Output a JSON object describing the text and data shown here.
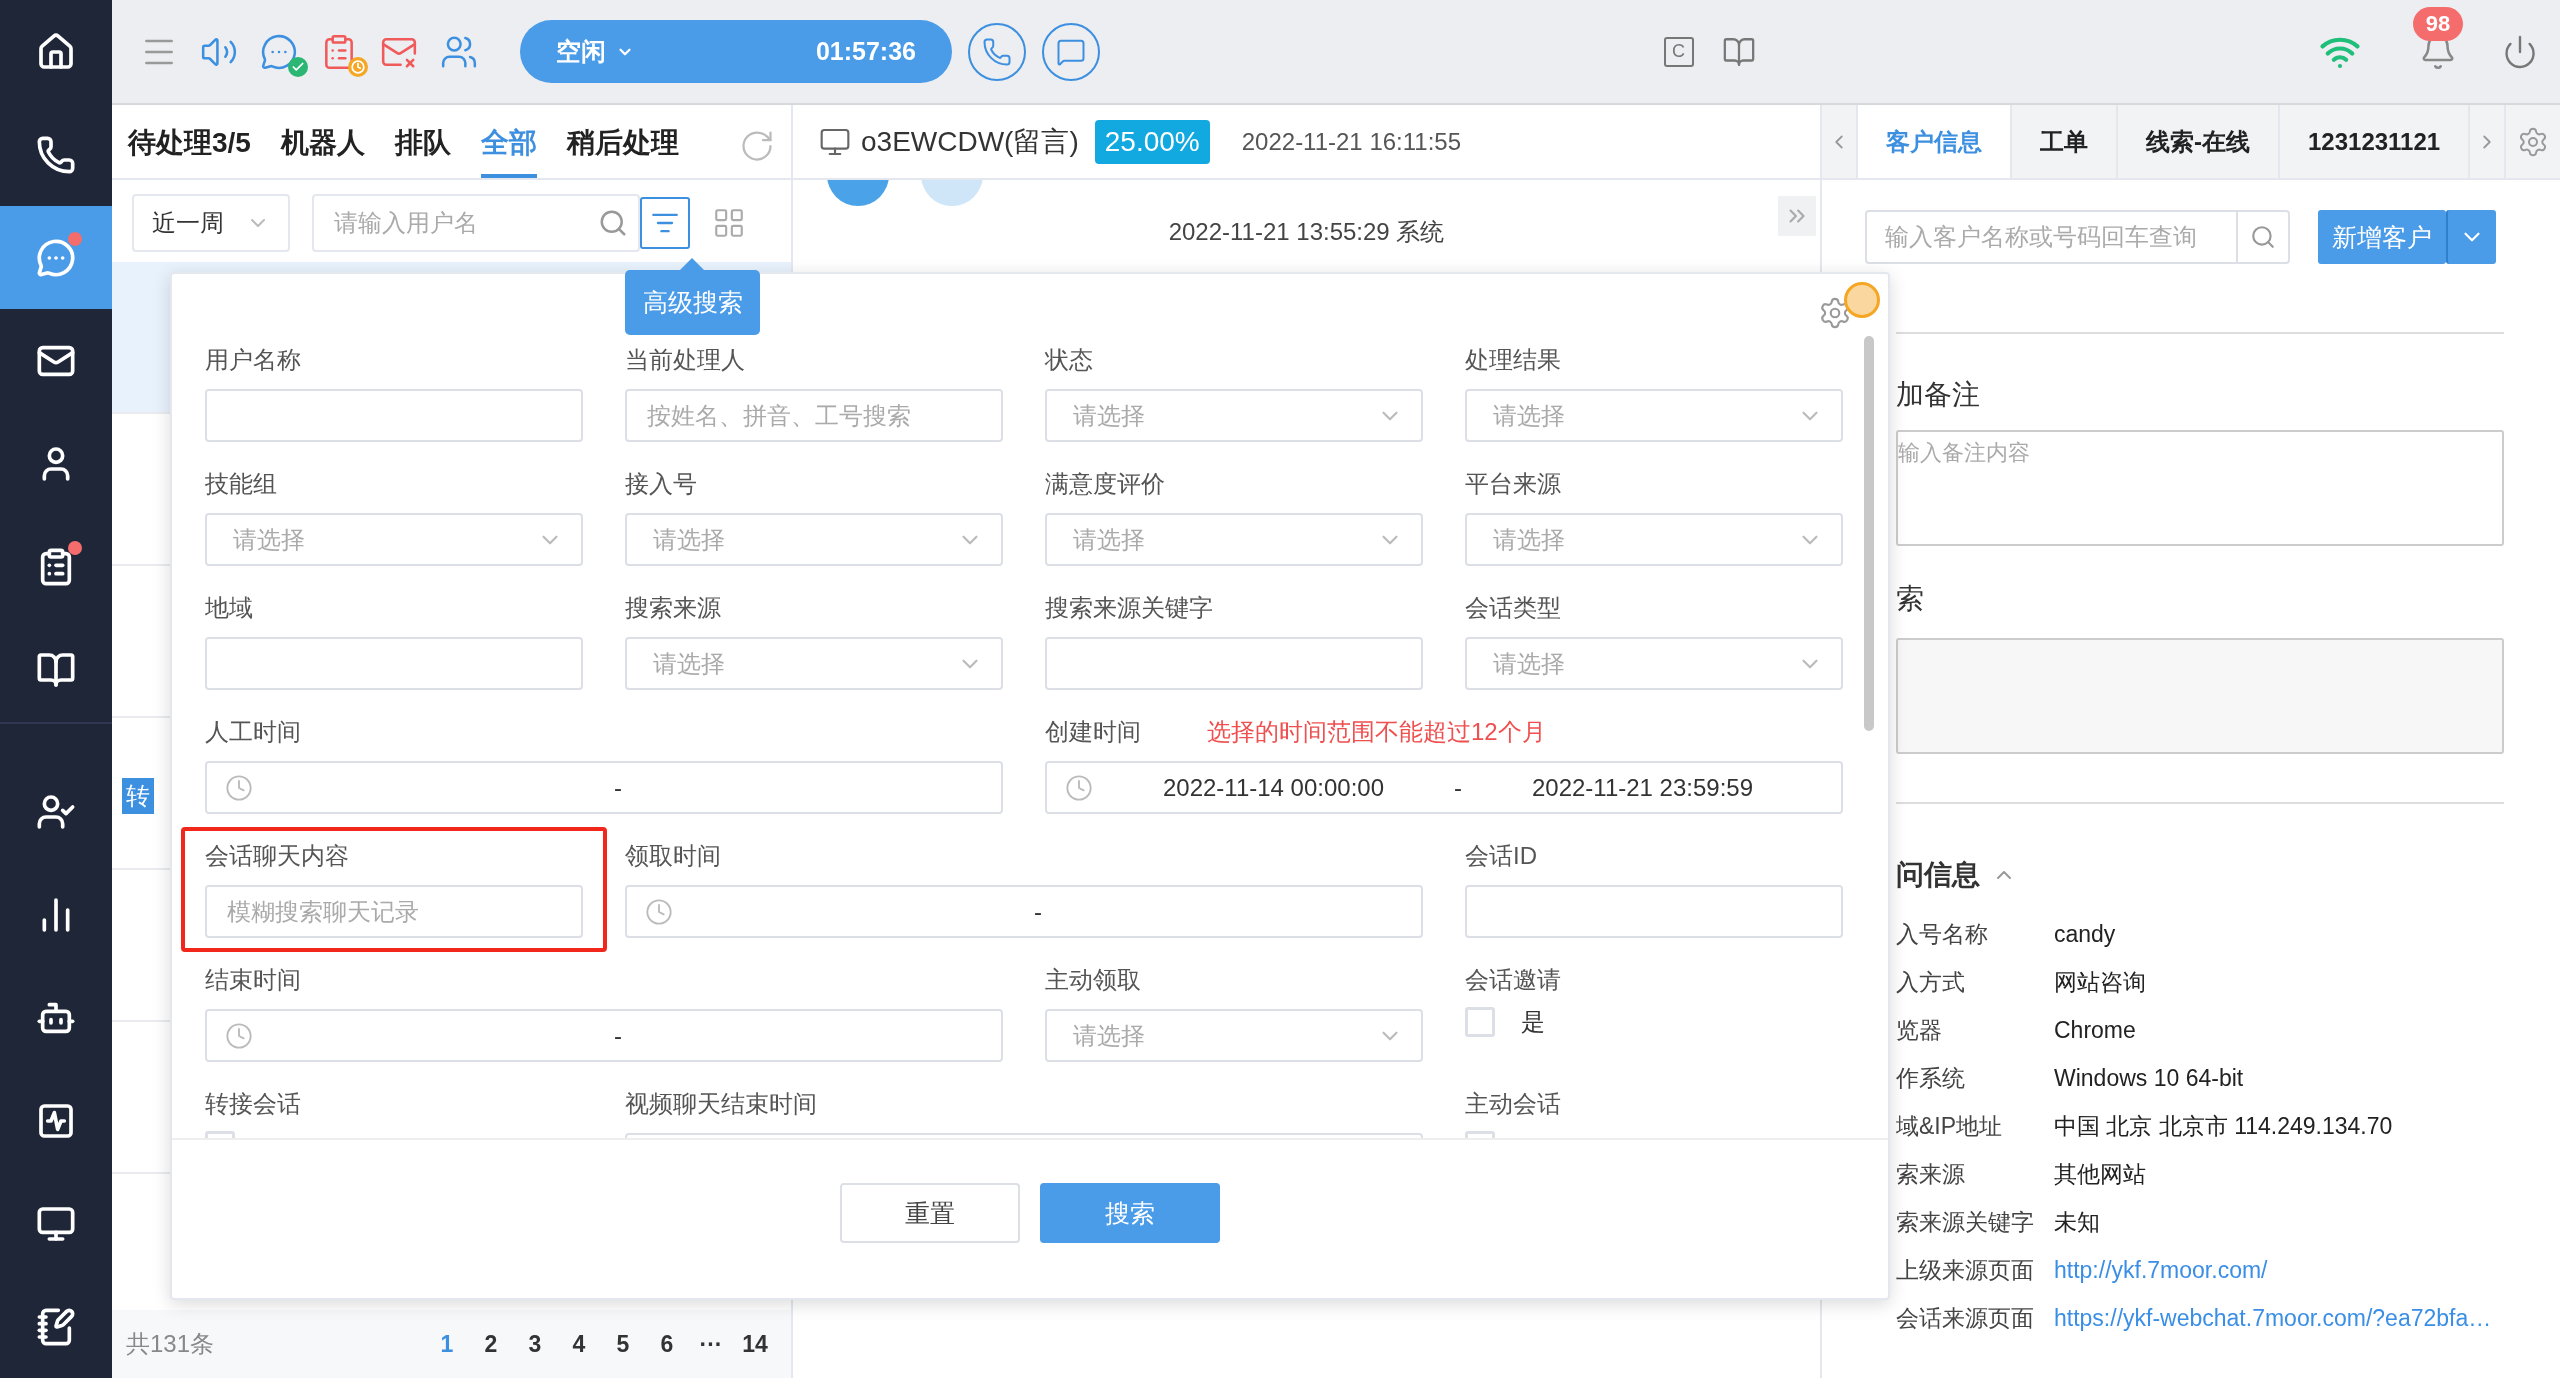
{
  "nav": {
    "top": [
      {
        "selected": false,
        "dot": false
      },
      {
        "selected": false,
        "dot": false
      },
      {
        "selected": true,
        "dot": true
      },
      {
        "selected": false,
        "dot": false
      },
      {
        "selected": false,
        "dot": false
      },
      {
        "selected": false,
        "dot": true
      },
      {
        "selected": false,
        "dot": false
      }
    ],
    "bottom": [
      {
        "selected": false,
        "dot": false
      },
      {
        "selected": false,
        "dot": false
      },
      {
        "selected": false,
        "dot": false
      },
      {
        "selected": false,
        "dot": false
      },
      {
        "selected": false,
        "dot": false
      },
      {
        "selected": false,
        "dot": false
      }
    ]
  },
  "toolbar": {
    "tools": [
      {
        "disabled": false,
        "online": false,
        "away": false
      },
      {
        "disabled": false,
        "online": false,
        "away": false
      },
      {
        "disabled": false,
        "online": true,
        "away": false
      },
      {
        "disabled": true,
        "online": false,
        "away": true
      },
      {
        "disabled": true,
        "online": false,
        "away": false
      },
      {
        "disabled": false,
        "online": false,
        "away": false
      }
    ],
    "status": {
      "label": "空闲",
      "timer": "01:57:36"
    },
    "key_label": "C",
    "notifications": "98"
  },
  "left_panel": {
    "tabs": [
      {
        "label": "待处理3/5",
        "selected": false
      },
      {
        "label": "机器人",
        "selected": false
      },
      {
        "label": "排队",
        "selected": false
      },
      {
        "label": "全部",
        "selected": true
      },
      {
        "label": "稍后处理",
        "selected": false
      }
    ],
    "period": "近一周",
    "search": {
      "placeholder": "请输入用户名"
    },
    "filter_active": true,
    "rows": [
      {
        "selected": true
      },
      {
        "selected": false
      },
      {
        "selected": false
      },
      {
        "selected": false,
        "tag": "转"
      },
      {
        "selected": false
      },
      {
        "selected": false
      },
      {
        "selected": false
      }
    ],
    "total": "共131条",
    "pages": [
      {
        "label": "1",
        "selected": true
      },
      {
        "label": "2",
        "selected": false
      },
      {
        "label": "3",
        "selected": false
      },
      {
        "label": "4",
        "selected": false
      },
      {
        "label": "5",
        "selected": false
      },
      {
        "label": "6",
        "selected": false
      },
      {
        "label": "···",
        "selected": false
      },
      {
        "label": "14",
        "selected": false
      }
    ]
  },
  "chat": {
    "title": "o3EWCDW(留言)",
    "percent": "25.00%",
    "time": "2022-11-21 16:11:55",
    "system_line": "2022-11-21 13:55:29 系统"
  },
  "right_panel": {
    "tabs": [
      {
        "label": "客户信息",
        "selected": true
      },
      {
        "label": "工单",
        "selected": false
      },
      {
        "label": "线索-在线",
        "selected": false
      },
      {
        "label": "1231231121",
        "selected": false
      }
    ],
    "search": {
      "placeholder": "输入客户名称或号码回车查询"
    },
    "add_button": "新增客户",
    "remark_title": "加备注",
    "remark": {
      "placeholder": "输入备注内容"
    },
    "search_section": "索",
    "visit_title": "问信息",
    "visit_expanded": true,
    "visit_rows": [
      {
        "label": "入号名称",
        "value": "candy",
        "kind": "text"
      },
      {
        "label": "入方式",
        "value": "网站咨询",
        "kind": "text"
      },
      {
        "label": "览器",
        "value": "Chrome",
        "kind": "text"
      },
      {
        "label": "作系统",
        "value": "Windows 10 64-bit",
        "kind": "text"
      },
      {
        "label": "域&IP地址",
        "value": "中国 北京 北京市 114.249.134.70",
        "kind": "text"
      },
      {
        "label": "索来源",
        "value": "其他网站",
        "kind": "text"
      },
      {
        "label": "索来源关键字",
        "value": "未知",
        "kind": "text"
      },
      {
        "label": "上级来源页面",
        "value": "http://ykf.7moor.com/",
        "kind": "link"
      },
      {
        "label": "会话来源页面",
        "value": "https://ykf-webchat.7moor.com/?ea72bfa…",
        "kind": "link"
      }
    ]
  },
  "popup": {
    "tooltip": "高级搜索",
    "fields": [
      {
        "label": "用户名称",
        "kind": "input"
      },
      {
        "label": "当前处理人",
        "kind": "input",
        "placeholder": "按姓名、拼音、工号搜索"
      },
      {
        "label": "状态",
        "kind": "select",
        "placeholder": "请选择"
      },
      {
        "label": "处理结果",
        "kind": "select",
        "placeholder": "请选择"
      },
      {
        "label": "技能组",
        "kind": "select",
        "placeholder": "请选择"
      },
      {
        "label": "接入号",
        "kind": "select",
        "placeholder": "请选择"
      },
      {
        "label": "满意度评价",
        "kind": "select",
        "placeholder": "请选择"
      },
      {
        "label": "平台来源",
        "kind": "select",
        "placeholder": "请选择"
      },
      {
        "label": "地域",
        "kind": "input"
      },
      {
        "label": "搜索来源",
        "kind": "select",
        "placeholder": "请选择"
      },
      {
        "label": "搜索来源关键字",
        "kind": "input"
      },
      {
        "label": "会话类型",
        "kind": "select",
        "placeholder": "请选择"
      },
      {
        "label": "人工时间",
        "kind": "range",
        "separator": "-"
      },
      {
        "label": "创建时间",
        "kind": "range",
        "hint": "选择的时间范围不能超过12个月",
        "from": "2022-11-14 00:00:00",
        "separator": "-",
        "to": "2022-11-21 23:59:59"
      },
      {
        "label": "会话聊天内容",
        "kind": "input",
        "placeholder": "模糊搜索聊天记录",
        "highlighted": true
      },
      {
        "label": "领取时间",
        "kind": "range",
        "separator": "-"
      },
      {
        "label": "会话ID",
        "kind": "input"
      },
      {
        "label": "结束时间",
        "kind": "range",
        "separator": "-"
      },
      {
        "label": "主动领取",
        "kind": "select",
        "placeholder": "请选择"
      },
      {
        "label": "会话邀请",
        "kind": "checkbox",
        "option": "是",
        "checked": false
      },
      {
        "label": "转接会话",
        "kind": "checkbox",
        "checked": false
      },
      {
        "label": "视频聊天结束时间",
        "kind": "range"
      },
      {
        "label": "主动会话",
        "kind": "checkbox",
        "checked": false
      }
    ],
    "buttons": [
      {
        "label": "重置",
        "primary": false
      },
      {
        "label": "搜索",
        "primary": true
      }
    ]
  }
}
